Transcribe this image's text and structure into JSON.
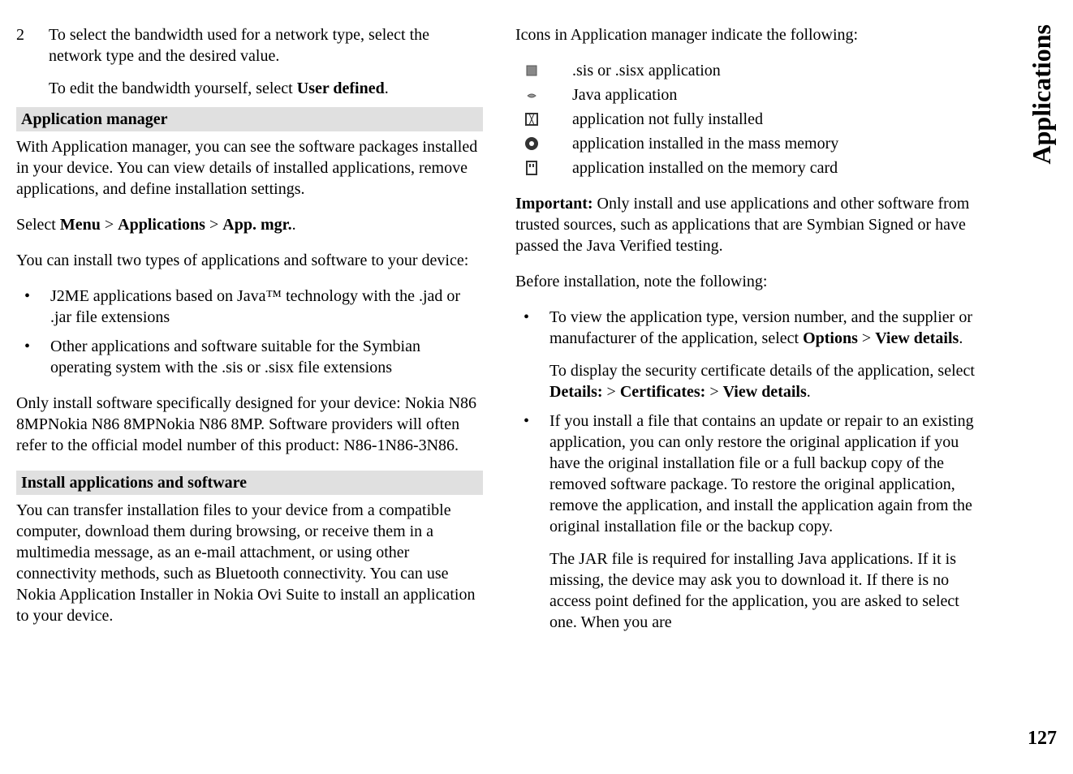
{
  "sideLabel": "Applications",
  "pageNumber": "127",
  "left": {
    "numbered": {
      "num": "2",
      "text1": "To select the bandwidth used for a network type, select the network type and the desired value.",
      "text2a": "To edit the bandwidth yourself, select ",
      "text2b": "User defined",
      "text2c": "."
    },
    "header1": "Application manager",
    "para1": "With Application manager, you can see the software packages installed in your device. You can view details of installed applications, remove applications, and define installation settings.",
    "para2a": "Select ",
    "para2b": "Menu",
    "para2c": " > ",
    "para2d": "Applications",
    "para2e": " > ",
    "para2f": "App. mgr.",
    "para2g": ".",
    "para3": "You can install two types of applications and software to your device:",
    "bullet1": "J2ME applications based on Java™ technology with the .jad or .jar file extensions",
    "bullet2": "Other applications and software suitable for the Symbian operating system with the .sis or .sisx file extensions",
    "para4": "Only install software specifically designed for your device: Nokia N86 8MPNokia N86 8MPNokia N86 8MP. Software providers will often refer to the official model number of this product: N86-1N86-3N86.",
    "header2": "Install applications and software",
    "para5": "You can transfer installation files to your device from a compatible computer, download them during browsing, or receive them in a multimedia message, as an e-mail attachment, or using other connectivity methods, such as Bluetooth connectivity. You can use Nokia Application Installer in Nokia Ovi Suite to install an application to your device."
  },
  "right": {
    "para1": "Icons in Application manager indicate the following:",
    "icons": {
      "row1": ".sis or .sisx application",
      "row2": "Java application",
      "row3": "application not fully installed",
      "row4": "application installed in the mass memory",
      "row5": "application installed on the memory card"
    },
    "para2a": "Important:",
    "para2b": "  Only install and use applications and other software from trusted sources, such as applications that are Symbian Signed or have passed the Java Verified testing.",
    "para3": "Before installation, note the following:",
    "bullet1a": "To view the application type, version number, and the supplier or manufacturer of the application, select ",
    "bullet1b": "Options",
    "bullet1c": " > ",
    "bullet1d": "View details",
    "bullet1e": ".",
    "bullet1_sub_a": "To display the security certificate details of the application, select ",
    "bullet1_sub_b": "Details:",
    "bullet1_sub_c": " > ",
    "bullet1_sub_d": "Certificates:",
    "bullet1_sub_e": " > ",
    "bullet1_sub_f": "View details",
    "bullet1_sub_g": ".",
    "bullet2": "If you install a file that contains an update or repair to an existing application, you can only restore the original application if you have the original installation file or a full backup copy of the removed software package. To restore the original application, remove the application, and install the application again from the original installation file or the backup copy.",
    "bullet2_sub": "The JAR file is required for installing Java applications. If it is missing, the device may ask you to download it. If there is no access point defined for the application, you are asked to select one. When you are"
  }
}
